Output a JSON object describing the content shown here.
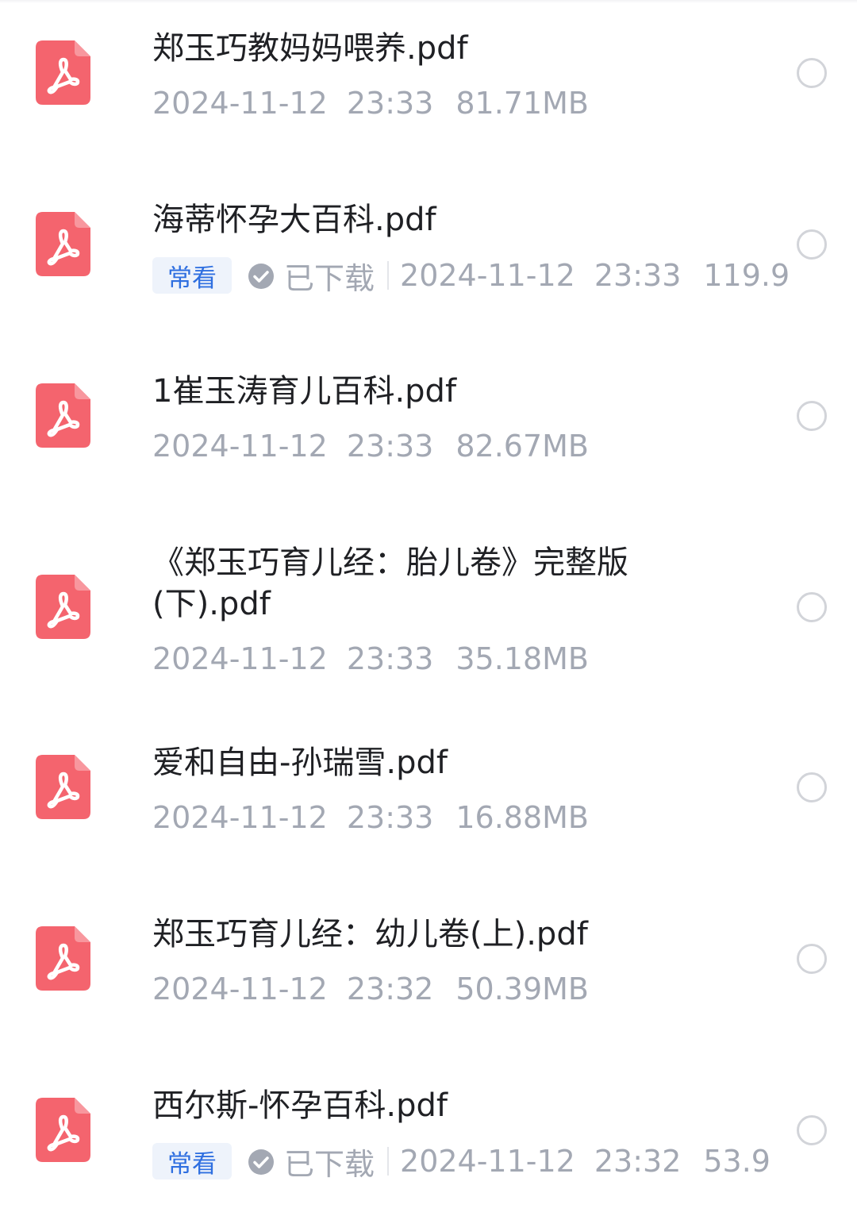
{
  "files": [
    {
      "name": "郑玉巧教妈妈喂养.pdf",
      "date": "2024-11-12",
      "time": "23:33",
      "size": "81.71MB"
    },
    {
      "name": "海蒂怀孕大百科.pdf",
      "badge": "常看",
      "status": "已下载",
      "date": "2024-11-12",
      "time": "23:33",
      "size": "119.9"
    },
    {
      "name": "1崔玉涛育儿百科.pdf",
      "date": "2024-11-12",
      "time": "23:33",
      "size": "82.67MB"
    },
    {
      "name_line1": "《郑玉巧育儿经：胎儿卷》完整版",
      "name_line2": "(下).pdf",
      "date": "2024-11-12",
      "time": "23:33",
      "size": "35.18MB"
    },
    {
      "name": "爱和自由-孙瑞雪.pdf",
      "date": "2024-11-12",
      "time": "23:33",
      "size": "16.88MB"
    },
    {
      "name": "郑玉巧育儿经：幼儿卷(上).pdf",
      "date": "2024-11-12",
      "time": "23:32",
      "size": "50.39MB"
    },
    {
      "name": "西尔斯-怀孕百科.pdf",
      "badge": "常看",
      "status": "已下载",
      "date": "2024-11-12",
      "time": "23:32",
      "size": "53.9"
    }
  ],
  "icons": {
    "file": "pdf-file-icon",
    "status": "check-circle-icon",
    "select": "radio-circle"
  },
  "colors": {
    "pdf_icon": "#f4646e",
    "badge_bg": "#eef3fb",
    "badge_text": "#2f6fe0",
    "meta_text": "#a3a8b3",
    "title_text": "#1f2024"
  }
}
